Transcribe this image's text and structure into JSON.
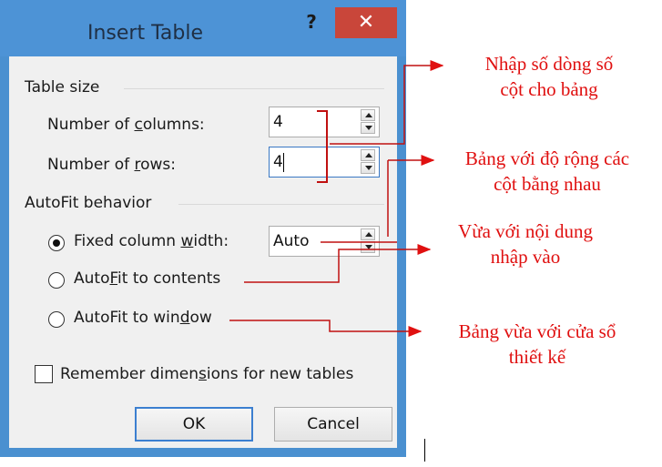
{
  "dialog": {
    "title": "Insert Table",
    "help_label": "?",
    "close_label": "✕"
  },
  "table_size": {
    "group_label": "Table size",
    "columns_label_pre": "Number of ",
    "columns_label_key": "c",
    "columns_label_post": "olumns:",
    "columns_value": "4",
    "rows_label_pre": "Number of ",
    "rows_label_key": "r",
    "rows_label_post": "ows:",
    "rows_value": "4"
  },
  "autofit": {
    "group_label": "AutoFit behavior",
    "fixed_pre": "Fixed column ",
    "fixed_key": "w",
    "fixed_post": "idth:",
    "fixed_value": "Auto",
    "contents_pre": "Auto",
    "contents_key": "F",
    "contents_post": "it to contents",
    "window_pre": "AutoFit to win",
    "window_key": "d",
    "window_post": "ow",
    "selected": "fixed"
  },
  "remember": {
    "pre": "Remember dimen",
    "key": "s",
    "post": "ions for new tables",
    "checked": false
  },
  "buttons": {
    "ok": "OK",
    "cancel": "Cancel"
  },
  "annotations": {
    "note1_line1": "Nhập số dòng số",
    "note1_line2": "cột cho bảng",
    "note2_line1": "Bảng với độ rộng các",
    "note2_line2": "cột bằng nhau",
    "note3_line1": "Vừa với nội dung",
    "note3_line2": "nhập vào",
    "note4_line1": "Bảng vừa với cửa sổ",
    "note4_line2": "thiết kế",
    "color": "#e01010"
  }
}
